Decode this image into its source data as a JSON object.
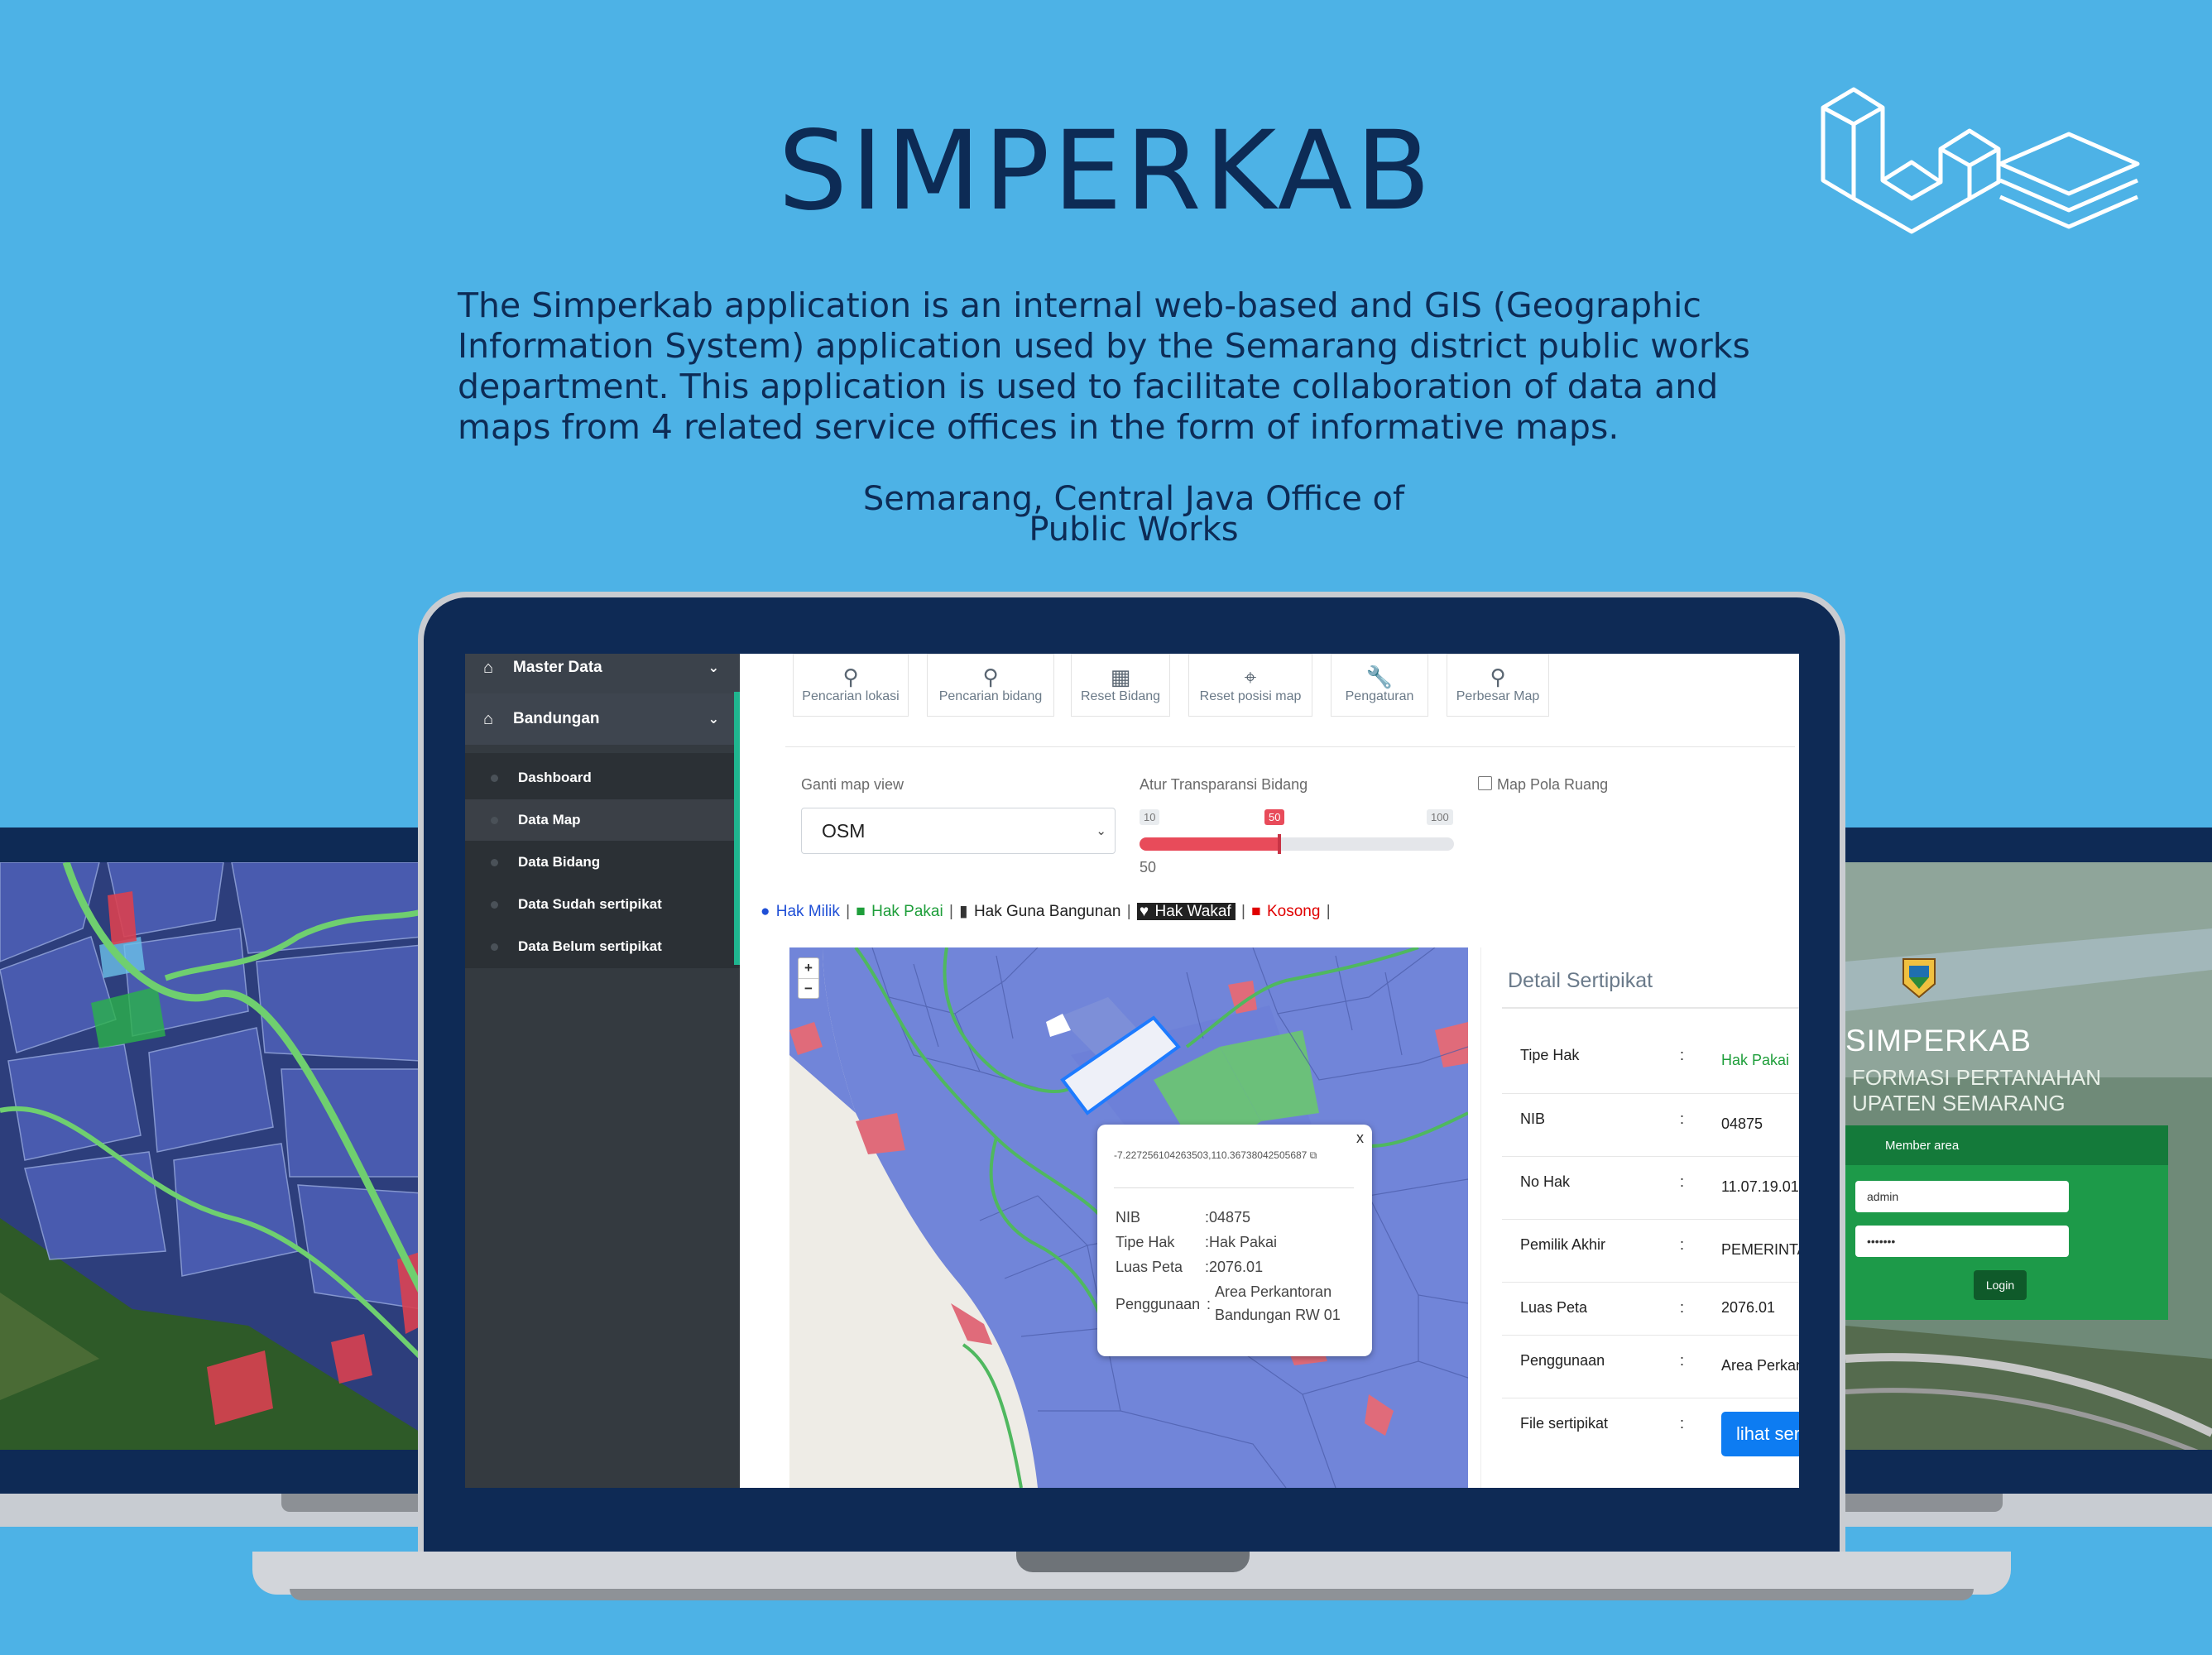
{
  "header": {
    "title": "SIMPERKAB",
    "description": "The Simperkab application is an internal web-based and GIS (Geographic Information System) application used by the Semarang district public works department. This application is used to facilitate collaboration of data and maps from 4 related service offices in the form of informative maps.",
    "location_line1": "Semarang, Central Java Office of",
    "location_line2": "Public Works"
  },
  "sidebar": {
    "master_data": "Master Data",
    "bandungan": "Bandungan",
    "items": [
      {
        "label": "Dashboard"
      },
      {
        "label": "Data Map"
      },
      {
        "label": "Data Bidang"
      },
      {
        "label": "Data Sudah sertipikat"
      },
      {
        "label": "Data Belum sertipikat"
      }
    ]
  },
  "toolbar": {
    "items": [
      {
        "label": "Pencarian lokasi",
        "icon": "map-pin-icon"
      },
      {
        "label": "Pencarian bidang",
        "icon": "search-icon"
      },
      {
        "label": "Reset Bidang",
        "icon": "map-icon"
      },
      {
        "label": "Reset posisi map",
        "icon": "crosshair-icon"
      },
      {
        "label": "Pengaturan",
        "icon": "wrench-icon"
      },
      {
        "label": "Perbesar Map",
        "icon": "map-pin-icon"
      }
    ]
  },
  "controls": {
    "map_view_label": "Ganti map view",
    "map_view_value": "OSM",
    "transparency_label": "Atur Transparansi Bidang",
    "slider_min": "10",
    "slider_max": "100",
    "slider_value": 50,
    "slider_value_label": "50",
    "slider_value_text": "50",
    "pola_ruang_label": "Map Pola Ruang"
  },
  "legend": {
    "hak_milik": "Hak Milik",
    "hak_pakai": "Hak Pakai",
    "hak_guna": "Hak Guna Bangunan",
    "hak_wakaf": "Hak Wakaf",
    "kosong": "Kosong",
    "colors": {
      "hak_milik": "#1f4fd6",
      "hak_pakai": "#1e9e3a",
      "hak_guna": "#222222",
      "kosong": "#e00000"
    }
  },
  "map": {
    "zoom_in": "+",
    "zoom_out": "−",
    "popup": {
      "coordinates": "-7.227256104263503,110.36738042505687",
      "close": "x",
      "nib_label": "NIB",
      "nib_value": "04875",
      "tipe_label": "Tipe Hak",
      "tipe_value": "Hak Pakai",
      "luas_label": "Luas Peta",
      "luas_value": "2076.01",
      "guna_label": "Penggunaan",
      "guna_value1": "Area Perkantoran",
      "guna_value2": "Bandungan RW 01",
      "sep": ":"
    }
  },
  "detail": {
    "title": "Detail Sertipikat",
    "colon": ":",
    "rows": [
      {
        "label": "Tipe Hak",
        "value": "Hak Pakai"
      },
      {
        "label": "NIB",
        "value": "04875"
      },
      {
        "label": "No Hak",
        "value": "11.07.19.01"
      },
      {
        "label": "Pemilik Akhir",
        "value": "PEMERINTA"
      },
      {
        "label": "Luas Peta",
        "value": "2076.01"
      },
      {
        "label": "Penggunaan",
        "value": "Area Perkan"
      },
      {
        "label": "File sertipikat",
        "value": "lihat ser"
      }
    ]
  },
  "login": {
    "title": "SIMPERKAB",
    "subtitle1": "FORMASI PERTANAHAN",
    "subtitle2": "UPATEN SEMARANG",
    "member_area": "Member area",
    "username": "admin",
    "password": "•••••••",
    "button": "Login"
  },
  "colors": {
    "background": "#4db2e6",
    "frame": "#0e2a55",
    "accent": "#1fb58f",
    "primary": "#0d7cf2"
  }
}
